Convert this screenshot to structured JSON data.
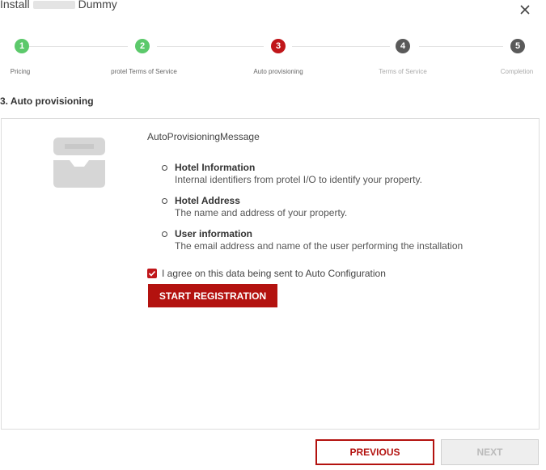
{
  "dialog": {
    "title_prefix": "Install",
    "title_suffix": "Dummy",
    "close_icon": "close-icon"
  },
  "steps": [
    {
      "number": "1",
      "label": "Pricing",
      "status": "done"
    },
    {
      "number": "2",
      "label": "protel Terms of Service",
      "status": "done"
    },
    {
      "number": "3",
      "label": "Auto provisioning",
      "status": "active"
    },
    {
      "number": "4",
      "label": "Terms of Service",
      "status": "todo"
    },
    {
      "number": "5",
      "label": "Completion",
      "status": "todo"
    }
  ],
  "section_title": "3. Auto provisioning",
  "content": {
    "message": "AutoProvisioningMessage",
    "items": [
      {
        "heading": "Hotel Information",
        "description": "Internal identifiers from protel I/O to identify your property."
      },
      {
        "heading": "Hotel Address",
        "description": "The name and address of your property."
      },
      {
        "heading": "User information",
        "description": "The email address and name of the user performing the installation"
      }
    ],
    "agree_label": "I agree on this data being sent to Auto Configuration",
    "agree_checked": true,
    "start_button": "START REGISTRATION"
  },
  "footer": {
    "previous_button": "PREVIOUS",
    "next_button": "NEXT",
    "next_disabled": true
  },
  "colors": {
    "accent": "#b3120f",
    "done": "#5cc96b",
    "todo": "#5a5a5a"
  }
}
